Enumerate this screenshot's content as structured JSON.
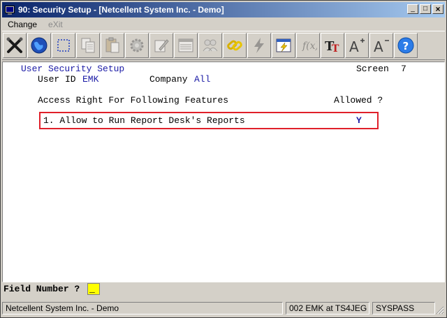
{
  "window": {
    "title": "90: Security Setup - [Netcellent System Inc. - Demo]",
    "title_icon": "terminal-app-icon",
    "minimize": "_",
    "maximize": "□",
    "close": "×"
  },
  "menu": [
    {
      "label": "Change",
      "enabled": true
    },
    {
      "label": "eXit",
      "enabled": false
    }
  ],
  "toolbar": [
    {
      "name": "exit-tool",
      "icon": "x-tools-icon"
    },
    {
      "name": "globe-tool",
      "icon": "globe-icon"
    },
    {
      "name": "select-tool",
      "icon": "dashed-rect-icon"
    },
    {
      "name": "copy-tool",
      "icon": "copy-icon"
    },
    {
      "name": "paste-tool",
      "icon": "paste-icon"
    },
    {
      "name": "settings-tool",
      "icon": "gear-icon"
    },
    {
      "name": "edit-tool",
      "icon": "pencil-doc-icon"
    },
    {
      "name": "list-tool",
      "icon": "list-icon"
    },
    {
      "name": "users-tool",
      "icon": "users-icon"
    },
    {
      "name": "link-tool",
      "icon": "chain-icon"
    },
    {
      "name": "lightning-tool",
      "icon": "lightning-icon"
    },
    {
      "name": "window-tool",
      "icon": "window-lightning-icon"
    },
    {
      "name": "function-tool",
      "icon": "function-icon"
    },
    {
      "name": "font-tool",
      "icon": "tt-font-icon"
    },
    {
      "name": "font-bigger-tool",
      "icon": "font-increase-icon"
    },
    {
      "name": "font-smaller-tool",
      "icon": "font-decrease-icon"
    },
    {
      "name": "help-tool",
      "icon": "help-icon"
    }
  ],
  "screen": {
    "heading": "User Security Setup",
    "screen_label": "Screen",
    "screen_number": "7",
    "user_id_label": "User ID",
    "user_id": "EMK",
    "company_label": "Company",
    "company": "All",
    "access_header": "Access Right For Following Features",
    "allowed_header": "Allowed ?",
    "features": [
      {
        "label": "1. Allow to Run Report Desk's Reports",
        "value": "Y"
      }
    ]
  },
  "field": {
    "label": "Field Number ?",
    "value": "_"
  },
  "status": {
    "company": "Netcellent System Inc. - Demo",
    "session": "002 EMK at TS4JEG",
    "database": "SYSPASS"
  },
  "colors": {
    "title_start": "#0a246a",
    "title_end": "#a6caf0",
    "terminal_text_blue": "#1a1aa6",
    "highlight_border": "#e0202a",
    "input_bg": "#ffff00"
  }
}
